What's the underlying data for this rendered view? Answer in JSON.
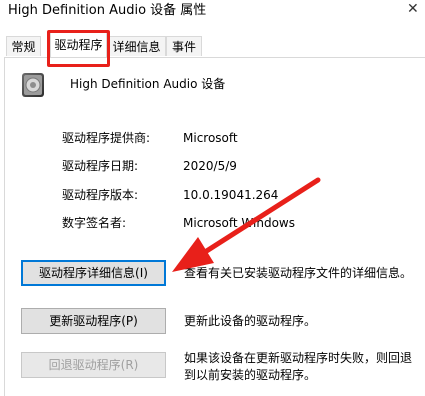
{
  "window": {
    "title": "High Definition Audio 设备 属性"
  },
  "tabs": [
    {
      "label": "常规",
      "active": false
    },
    {
      "label": "驱动程序",
      "active": true
    },
    {
      "label": "详细信息",
      "active": false
    },
    {
      "label": "事件",
      "active": false
    }
  ],
  "device": {
    "name": "High Definition Audio 设备",
    "icon": "speaker-icon"
  },
  "properties": [
    {
      "label": "驱动程序提供商:",
      "value": "Microsoft"
    },
    {
      "label": "驱动程序日期:",
      "value": "2020/5/9"
    },
    {
      "label": "驱动程序版本:",
      "value": "10.0.19041.264"
    },
    {
      "label": "数字签名者:",
      "value": "Microsoft Windows"
    }
  ],
  "actions": [
    {
      "button": "驱动程序详细信息(I)",
      "description": "查看有关已安装驱动程序文件的详细信息。",
      "enabled": true
    },
    {
      "button": "更新驱动程序(P)",
      "description": "更新此设备的驱动程序。",
      "enabled": true
    },
    {
      "button": "回退驱动程序(R)",
      "description": "如果该设备在更新驱动程序时失败，则回退到以前安装的驱动程序。",
      "enabled": false
    }
  ],
  "colors": {
    "annotation_red": "#e8201a",
    "focus_blue": "#0078d7"
  }
}
